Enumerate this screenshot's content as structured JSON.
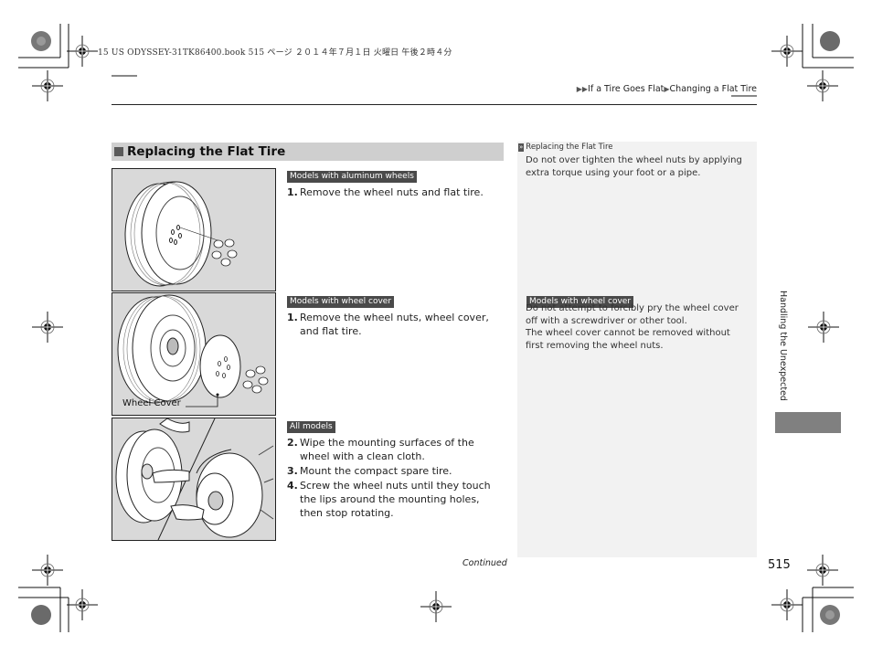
{
  "printer_header": "15 US ODYSSEY-31TK86400.book  515 ページ  ２０１４年７月１日  火曜日  午後２時４分",
  "breadcrumb": {
    "items": [
      "If a Tire Goes Flat",
      "Changing a Flat Tire"
    ],
    "arrow_icon": "▶▶"
  },
  "section": {
    "title": "Replacing the Flat Tire"
  },
  "figures": [
    {
      "label": ""
    },
    {
      "label": "Wheel Cover"
    },
    {
      "label": ""
    }
  ],
  "procedure": [
    {
      "tag": "Models with aluminum wheels",
      "steps": [
        {
          "num": "1.",
          "text": "Remove the wheel nuts and flat tire."
        }
      ]
    },
    {
      "tag": "Models with wheel cover",
      "steps": [
        {
          "num": "1.",
          "text": "Remove the wheel nuts, wheel cover, and flat tire."
        }
      ]
    },
    {
      "tag": "All models",
      "steps": [
        {
          "num": "2.",
          "text": "Wipe the mounting surfaces of the wheel with a clean cloth."
        },
        {
          "num": "3.",
          "text": "Mount the compact spare tire."
        },
        {
          "num": "4.",
          "text": "Screw the wheel nuts until they touch the lips around the mounting holes, then stop rotating."
        }
      ]
    }
  ],
  "side_panel": {
    "heading_icon": "»",
    "heading": "Replacing the Flat Tire",
    "note1": "Do not over tighten the wheel nuts by applying extra torque using your foot or a pipe.",
    "tag": "Models with wheel cover",
    "note2a": "Do not attempt to forcibly pry the wheel cover off with a screwdriver or other tool.",
    "note2b": "The wheel cover cannot be removed without first removing the wheel nuts."
  },
  "footer": {
    "continued": "Continued",
    "page_number": "515"
  },
  "chapter": {
    "label": "Handling the Unexpected"
  },
  "colors": {
    "section_bar": "#cfcfcf",
    "tag_bg": "#4a4a4a",
    "side_panel_bg": "#f2f2f2",
    "chapter_tab": "#808080"
  }
}
